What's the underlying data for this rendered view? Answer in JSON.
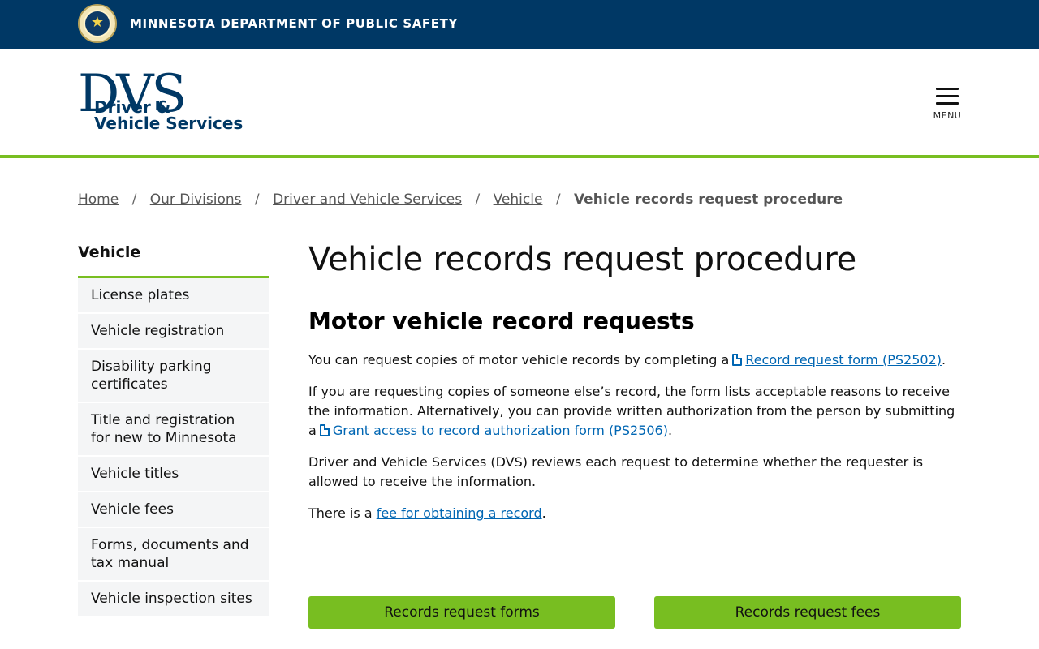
{
  "top_bar": {
    "seal_alt": "Minnesota Department of Public Safety seal",
    "title": "MINNESOTA DEPARTMENT OF PUBLIC SAFETY",
    "background_color": "#003865"
  },
  "header": {
    "logo": {
      "mark": "DVS",
      "line1": "Driver &",
      "line2": "Vehicle Services"
    },
    "menu_label": "MENU",
    "accent_color": "#78be21"
  },
  "breadcrumb": {
    "items": [
      "Home",
      "Our Divisions",
      "Driver and Vehicle Services",
      "Vehicle"
    ],
    "separator": "/",
    "current": "Vehicle records request procedure"
  },
  "sidebar": {
    "heading": "Vehicle",
    "items": [
      "License plates",
      "Vehicle registration",
      "Disability parking certificates",
      "Title and registration for new to Minnesota",
      "Vehicle titles",
      "Vehicle fees",
      "Forms, documents and tax manual",
      "Vehicle inspection sites"
    ]
  },
  "main": {
    "title": "Vehicle records request procedure",
    "section_title": "Motor vehicle record requests",
    "p1": {
      "text": "You can request copies of motor vehicle records by completing a",
      "link": "Record request form (PS2502)",
      "end": "."
    },
    "p2": {
      "text": "If you are requesting copies of someone else’s record, the form lists acceptable reasons to receive the information. Alternatively, you can provide written authorization from the person by submitting a",
      "link": "Grant access to record authorization form (PS2506)",
      "end": "."
    },
    "p3": {
      "text": "Driver and Vehicle Services (DVS) reviews each request to determine whether the requester is allowed to receive the information."
    },
    "p4": {
      "text": "There is a",
      "link": "fee for obtaining a record",
      "end": "."
    },
    "buttons": {
      "forms": "Records request forms",
      "fees": "Records request fees"
    },
    "link_color": "#0066b3"
  }
}
